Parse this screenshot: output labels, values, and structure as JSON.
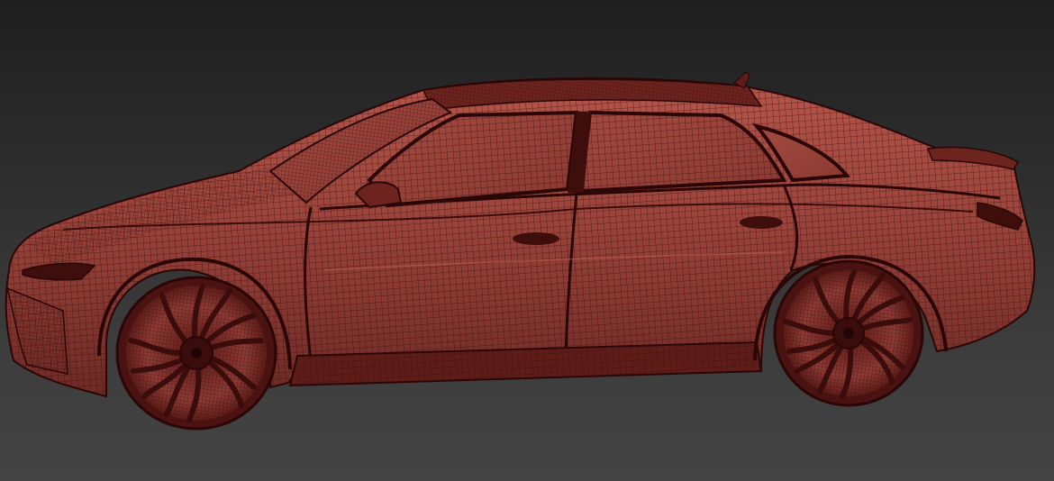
{
  "viewport": {
    "mode": "wireframe",
    "object": "car-mesh",
    "colors": {
      "background_top": "#1f1f1f",
      "background_bottom": "#444444",
      "mesh_fill": "#8e3b34",
      "mesh_fill_light": "#b5564a",
      "mesh_wire": "#3a0d0c",
      "mesh_edge": "#2a0606"
    }
  }
}
